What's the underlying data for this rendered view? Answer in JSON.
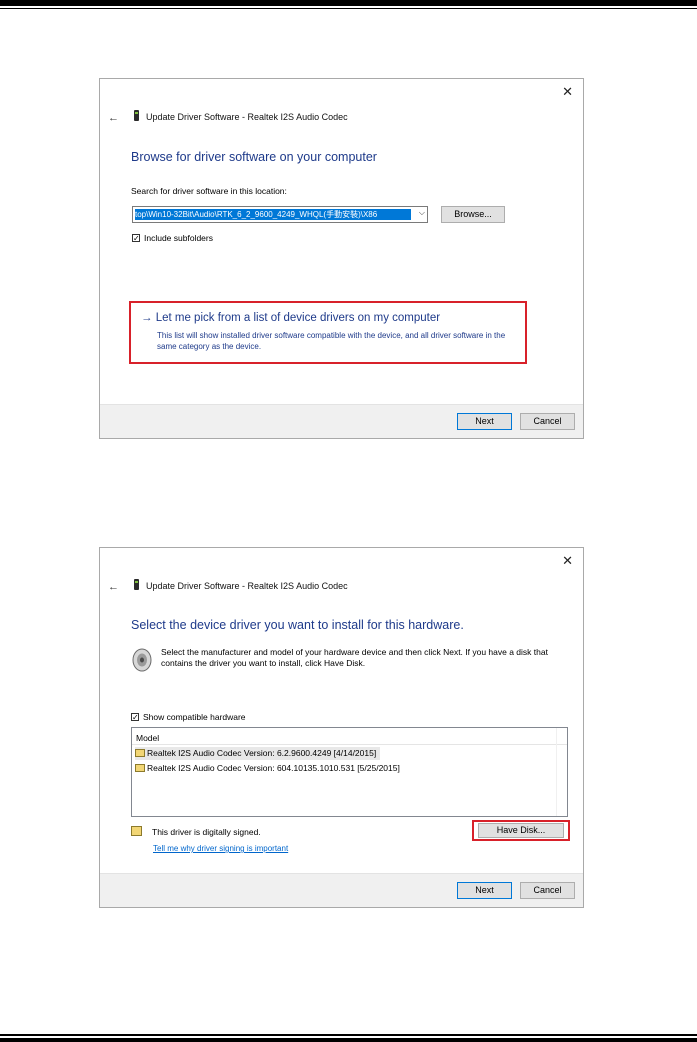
{
  "dialog1": {
    "close_icon": "✕",
    "back_icon": "←",
    "title": "Update Driver Software - Realtek I2S Audio Codec",
    "heading": "Browse for driver software on your computer",
    "search_label": "Search for driver software in this location:",
    "path_value": "top\\Win10-32Bit\\Audio\\RTK_6_2_9600_4249_WHQL(手動安裝)\\X86",
    "browse_label": "Browse...",
    "include_subfolders_label": "Include subfolders",
    "include_subfolders_checked": true,
    "pick_title": "→ Let me pick from a list of device drivers on my computer",
    "pick_desc": "This list will show installed driver software compatible with the device, and all driver software in the same category as the device.",
    "next_label": "Next",
    "cancel_label": "Cancel"
  },
  "dialog2": {
    "close_icon": "✕",
    "back_icon": "←",
    "title": "Update Driver Software - Realtek I2S Audio Codec",
    "heading": "Select the device driver you want to install for this hardware.",
    "description": "Select the manufacturer and model of your hardware device and then click Next. If you have a disk that contains the driver you want to install, click Have Disk.",
    "show_compatible_label": "Show compatible hardware",
    "show_compatible_checked": true,
    "list_header": "Model",
    "models": [
      "Realtek I2S Audio Codec Version: 6.2.9600.4249 [4/14/2015]",
      "Realtek I2S Audio Codec Version: 604.10135.1010.531 [5/25/2015]"
    ],
    "signed_text": "This driver is digitally signed.",
    "signing_link": "Tell me why driver signing is important",
    "have_disk_label": "Have Disk...",
    "next_label": "Next",
    "cancel_label": "Cancel"
  },
  "colors": {
    "accent_blue": "#1e3a8a",
    "highlight_red": "#d8212a",
    "selection_blue": "#0078d7"
  }
}
